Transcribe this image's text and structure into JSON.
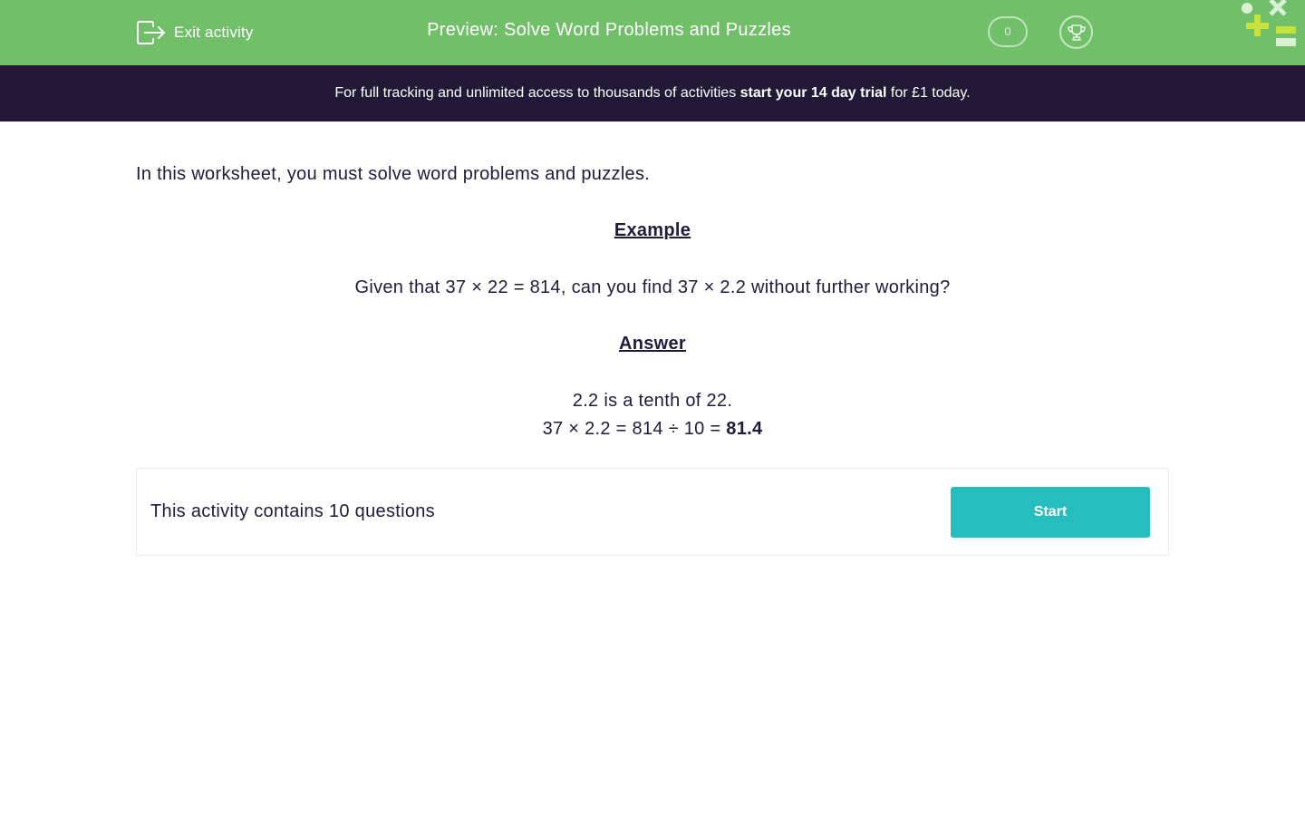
{
  "header": {
    "exit_label": "Exit activity",
    "title": "Preview: Solve Word Problems and Puzzles",
    "score": "0",
    "colors": {
      "background": "#72bf6a",
      "logo_lime": "#c8e23c",
      "logo_light": "#d9f0d4"
    },
    "icons": {
      "exit": "exit-icon",
      "trophy": "trophy-icon",
      "logo": "logo-icon"
    }
  },
  "banner": {
    "text_before": "For full tracking and unlimited access to thousands of activities ",
    "link_text": "start your 14 day trial",
    "text_after": " for £1 today.",
    "background": "#231937"
  },
  "content": {
    "intro": "In this worksheet, you must solve word problems and puzzles.",
    "example_heading": "Example",
    "example_question": "Given that 37 × 22 = 814, can you find 37 × 2.2 without further working?",
    "answer_heading": "Answer",
    "answer_line1": "2.2 is a tenth of 22.",
    "answer_line2_prefix": "37 × 2.2 = 814 ÷ 10 = ",
    "answer_line2_result": "81.4"
  },
  "activity": {
    "text": "This activity contains 10 questions",
    "start_label": "Start",
    "button_color": "#25bdbd"
  }
}
